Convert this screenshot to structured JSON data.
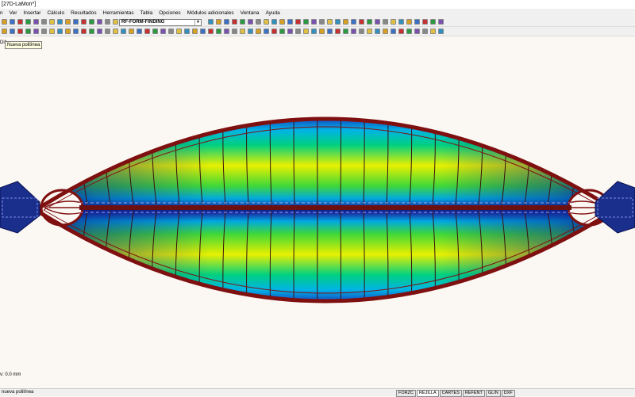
{
  "window": {
    "title": "[27D-LaMon*]"
  },
  "menu": [
    "n",
    "Ver",
    "Insertar",
    "Cálculo",
    "Resultados",
    "Herramientas",
    "Tabla",
    "Opciones",
    "Módulos adicionales",
    "Ventana",
    "Ayuda"
  ],
  "toolbar": {
    "module_combo": "RF-FORM-FINDING"
  },
  "tooltip": {
    "text": "Nueva polilínea"
  },
  "toolbar_fragment": "Dib",
  "viewport": {
    "coordinate_readout": "v: 0.0 mm"
  },
  "status": {
    "message": "nueva polilínea",
    "toggles": [
      "FORZC",
      "REJILLA",
      "CARTES",
      "REFENT",
      "GLIN",
      "DXF"
    ],
    "active": [
      "REJILLA"
    ]
  },
  "colors": {
    "frame": "#7f1010",
    "background": "#fbf8f4",
    "node_blue": "#1a2e8c"
  }
}
